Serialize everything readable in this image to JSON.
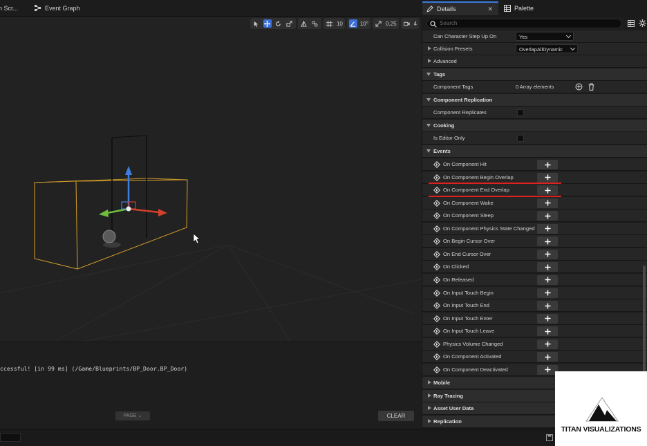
{
  "tabs": {
    "left": [
      {
        "label": "n Scr..."
      },
      {
        "label": "Event Graph"
      }
    ],
    "right": [
      {
        "label": "Details",
        "active": true
      },
      {
        "label": "Palette",
        "active": false
      }
    ]
  },
  "viewport": {
    "toolbar": {
      "grid_snap": "10",
      "rotation_snap": "10°",
      "scale_snap": "0.25",
      "camera_speed": "4"
    }
  },
  "output_log": {
    "line": "ccessful! [in 99 ms] (/Game/Blueprints/BP_Door.BP_Door)",
    "page_label": "PAGE",
    "clear_label": "CLEAR"
  },
  "details": {
    "search_placeholder": "Search",
    "rows": [
      {
        "kind": "prop",
        "label": "Can Character Step Up On",
        "value_type": "combo",
        "value": "Yes"
      },
      {
        "kind": "prop-collapsed",
        "label": "Collision Presets",
        "value_type": "combo",
        "value": "OverlapAllDynamic"
      },
      {
        "kind": "prop-collapsed",
        "label": "Advanced"
      },
      {
        "kind": "cat",
        "label": "Tags"
      },
      {
        "kind": "prop",
        "label": "Component Tags",
        "value_type": "array",
        "value": "0 Array elements"
      },
      {
        "kind": "cat",
        "label": "Component Replication"
      },
      {
        "kind": "prop",
        "label": "Component Replicates",
        "value_type": "checkbox",
        "checked": false
      },
      {
        "kind": "cat",
        "label": "Cooking"
      },
      {
        "kind": "prop",
        "label": "Is Editor Only",
        "value_type": "checkbox",
        "checked": false
      },
      {
        "kind": "cat",
        "label": "Events"
      }
    ],
    "events": [
      "On Component Hit",
      "On Component Begin Overlap",
      "On Component End Overlap",
      "On Component Wake",
      "On Component Sleep",
      "On Component Physics State Changed",
      "On Begin Cursor Over",
      "On End Cursor Over",
      "On Clicked",
      "On Released",
      "On Input Touch Begin",
      "On Input Touch End",
      "On Input Touch Enter",
      "On Input Touch Leave",
      "Physics Volume Changed",
      "On Component Activated",
      "On Component Deactivated"
    ],
    "collapsed_categories": [
      "Mobile",
      "Ray Tracing",
      "Asset User Data",
      "Replication"
    ]
  },
  "watermark": {
    "text": "TITAN VISUALIZATIONS"
  },
  "colors": {
    "accent": "#3b7be0",
    "highlight": "#e02020",
    "gizmo_x": "#d0402a",
    "gizmo_y": "#6fbf3a",
    "gizmo_z": "#3d7fe0",
    "bounds": "#c8962a"
  }
}
